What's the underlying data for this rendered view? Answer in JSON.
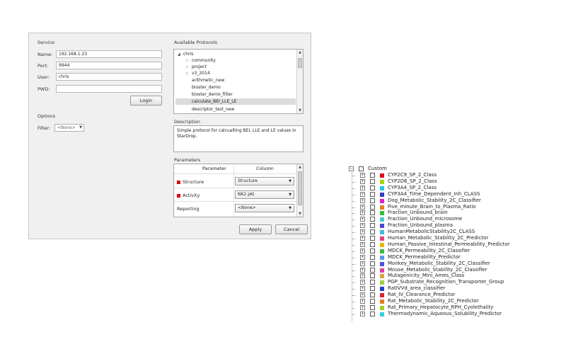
{
  "service": {
    "title": "Service",
    "name_label": "Name:",
    "name_value": "192.168.1.23",
    "port_label": "Port:",
    "port_value": "9944",
    "user_label": "User:",
    "user_value": "chris",
    "pwd_label": "PWD:",
    "pwd_value": "",
    "login_label": "Login"
  },
  "options": {
    "title": "Options",
    "filter_label": "Filter:",
    "filter_value": "<None>"
  },
  "protocols": {
    "title": "Available Protocols",
    "items": [
      {
        "label": "chris",
        "kind": "expanded"
      },
      {
        "label": "community",
        "kind": "collapsed"
      },
      {
        "label": "project",
        "kind": "collapsed"
      },
      {
        "label": "v3_2014",
        "kind": "collapsed"
      },
      {
        "label": "arithmetic_new",
        "kind": "leaf"
      },
      {
        "label": "bioster_demo",
        "kind": "leaf"
      },
      {
        "label": "bioster_demo_filter",
        "kind": "leaf"
      },
      {
        "label": "calculate_BEI_LLE_LE",
        "kind": "leaf",
        "selected": true
      },
      {
        "label": "descriptor_test_new",
        "kind": "leaf"
      }
    ]
  },
  "description": {
    "title": "Description",
    "text": "Simple protocol for calcualting BEI, LLE and LE values in StarDrop."
  },
  "parameters": {
    "title": "Parameters",
    "col_parameter": "Parameter",
    "col_column": "Column",
    "rows": [
      {
        "name": "Structure",
        "value": "Structure",
        "required": true
      },
      {
        "name": "Activity",
        "value": "NK2 pKi",
        "required": true
      },
      {
        "name": "Reporting",
        "value": "<None>",
        "required": false
      }
    ]
  },
  "buttons": {
    "apply": "Apply",
    "cancel": "Cancel"
  },
  "tree": {
    "root_label": "Custom",
    "items": [
      {
        "label": "CYP2C9_SP_2_Class",
        "color": "#e8001c"
      },
      {
        "label": "CYP2D6_SP_2_Class",
        "color": "#a6d608"
      },
      {
        "label": "CYP3A4_SP_2_Class",
        "color": "#20c8e8"
      },
      {
        "label": "CYP3A4_Time_Dependent_Inh_CLASS",
        "color": "#3838c8"
      },
      {
        "label": "Dog_Metabolic_Stability_2C_Classifier",
        "color": "#e020c0"
      },
      {
        "label": "Five_minute_Brain_to_Plasma_Ratio",
        "color": "#e88020"
      },
      {
        "label": "Fraction_Unbound_brain",
        "color": "#30c040"
      },
      {
        "label": "Fraction_Unbound_microsome",
        "color": "#40d0d0"
      },
      {
        "label": "Fraction_Unbound_plasma",
        "color": "#4848d8"
      },
      {
        "label": "HumanMetabolicStability2C_CLASS",
        "color": "#40b8e0"
      },
      {
        "label": "Human_Metabolic_Stability_2C_Predictor",
        "color": "#e8407c"
      },
      {
        "label": "Human_Passive_Intestinal_Permeability_Predictor",
        "color": "#e8b800"
      },
      {
        "label": "MDCK_Permeability_2C_Classifier",
        "color": "#40b840"
      },
      {
        "label": "MDCK_Permeability_Predictor",
        "color": "#50a0e8"
      },
      {
        "label": "Monkey_Metabolic_Stability_2C_Classifier",
        "color": "#5050e0"
      },
      {
        "label": "Mouse_Metabolic_Stability_2C_Classifier",
        "color": "#e040a0"
      },
      {
        "label": "Mutagenicity_Mini_Ames_Class",
        "color": "#e0a040"
      },
      {
        "label": "PGP_Substrate_Recognition_Transporter_Group",
        "color": "#a0d040"
      },
      {
        "label": "RatIVVd_area_classifier",
        "color": "#2040c8"
      },
      {
        "label": "Rat_IV_Clearance_Predictor",
        "color": "#e02030"
      },
      {
        "label": "Rat_Metabolic_Stability_2C_Predictor",
        "color": "#e08020"
      },
      {
        "label": "Rat_Primary_Hepatocyte_RPH_Cyolethality",
        "color": "#a0d020"
      },
      {
        "label": "Thermodynamic_Aqueous_Solubility_Predictor",
        "color": "#30d0e0"
      }
    ]
  }
}
